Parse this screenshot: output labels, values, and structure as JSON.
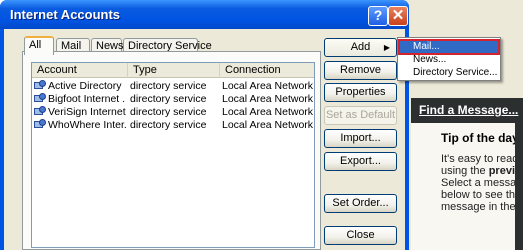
{
  "dialog": {
    "title": "Internet Accounts",
    "help_glyph": "?",
    "close_glyph": "✕"
  },
  "tabs": [
    {
      "label": "All",
      "active": true
    },
    {
      "label": "Mail",
      "active": false
    },
    {
      "label": "News",
      "active": false
    },
    {
      "label": "Directory Service",
      "active": false
    }
  ],
  "table": {
    "columns": [
      "Account",
      "Type",
      "Connection"
    ],
    "rows": [
      {
        "account": "Active Directory",
        "type": "directory service",
        "connection": "Local Area Network",
        "icon": "directory-service-icon"
      },
      {
        "account": "Bigfoot Internet ...",
        "type": "directory service",
        "connection": "Local Area Network",
        "icon": "directory-service-icon"
      },
      {
        "account": "VeriSign Internet ...",
        "type": "directory service",
        "connection": "Local Area Network",
        "icon": "directory-service-icon"
      },
      {
        "account": "WhoWhere Inter...",
        "type": "directory service",
        "connection": "Local Area Network",
        "icon": "directory-service-icon"
      }
    ]
  },
  "buttons": {
    "add": "Add",
    "add_arrow": "▶",
    "remove": "Remove",
    "properties": "Properties",
    "set_default": "Set as Default",
    "import": "Import...",
    "export": "Export...",
    "set_order": "Set Order...",
    "close": "Close"
  },
  "add_menu": {
    "items": [
      "Mail...",
      "News...",
      "Directory Service..."
    ],
    "highlighted_index": 0
  },
  "background_app": {
    "find_message": "Find a Message...",
    "tip_title": "Tip of the day",
    "tip_line1": "It's easy to read",
    "tip_line2_prefix": "using the ",
    "tip_line2_bold": "previ",
    "tip_line3": "Select a message",
    "tip_line4": "below to see the",
    "tip_line5": "message in the p"
  },
  "colors": {
    "titlebar": "#0054e3",
    "menu_highlight": "#316ac5",
    "menu_highlight_border": "#d6222b",
    "dialog_face": "#ece9d8"
  }
}
